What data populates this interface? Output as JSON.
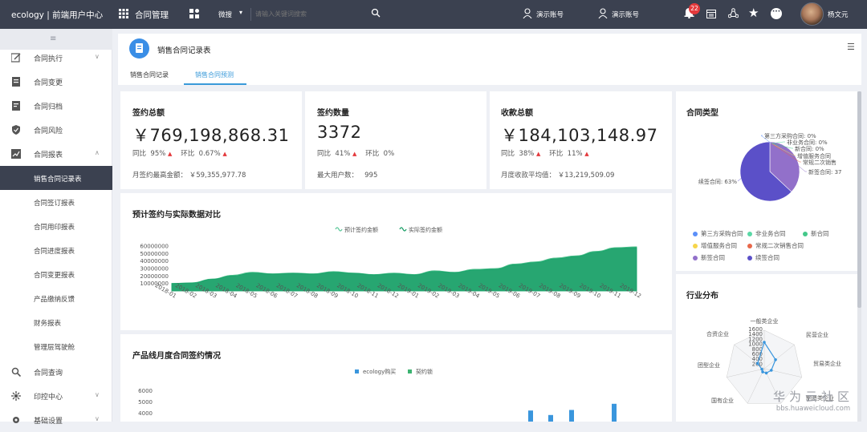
{
  "topbar": {
    "brand": "ecology | 前端用户中心",
    "module": "合同管理",
    "search_scope": "微搜",
    "search_placeholder": "请输入关键词搜索",
    "demo_account_1": "演示账号",
    "demo_account_2": "演示账号",
    "notification_count": "22",
    "username": "杨文元"
  },
  "sidebar": {
    "items": [
      {
        "label": "合同执行",
        "icon": "edit-icon",
        "chevron": "v"
      },
      {
        "label": "合同变更",
        "icon": "document-icon"
      },
      {
        "label": "合同归档",
        "icon": "archive-icon"
      },
      {
        "label": "合同风险",
        "icon": "shield-icon"
      },
      {
        "label": "合同报表",
        "icon": "chart-icon",
        "chevron": "^"
      }
    ],
    "subitems": [
      {
        "label": "销售合同记录表",
        "active": true
      },
      {
        "label": "合同签订报表"
      },
      {
        "label": "合同用印报表"
      },
      {
        "label": "合同进度报表"
      },
      {
        "label": "合同变更报表"
      },
      {
        "label": "产品缴纳反馈"
      },
      {
        "label": "财务报表"
      },
      {
        "label": "管理层驾驶舱"
      }
    ],
    "bottom_items": [
      {
        "label": "合同查询",
        "icon": "search-icon"
      },
      {
        "label": "印控中心",
        "icon": "settings-icon",
        "chevron": "v"
      },
      {
        "label": "基础设置",
        "icon": "gear-icon",
        "chevron": "v"
      }
    ]
  },
  "page": {
    "title": "销售合同记录表",
    "tabs": [
      {
        "label": "销售合同记录",
        "active": false
      },
      {
        "label": "销售合同预测",
        "active": true
      }
    ]
  },
  "kpis": [
    {
      "title": "签约总额",
      "value": "￥769,198,868.31",
      "yoy_label": "同比",
      "yoy": "95%",
      "yoy_up": true,
      "mom_label": "环比",
      "mom": "0.67%",
      "mom_up": true,
      "footer_label": "月签约最高金额：",
      "footer_value": "￥59,355,977.78"
    },
    {
      "title": "签约数量",
      "value": "3372",
      "yoy_label": "同比",
      "yoy": "41%",
      "yoy_up": true,
      "mom_label": "环比",
      "mom": "0%",
      "mom_up": false,
      "footer_label": "最大用户数：",
      "footer_value": "995"
    },
    {
      "title": "收款总额",
      "value": "￥184,103,148.97",
      "yoy_label": "同比",
      "yoy": "38%",
      "yoy_up": true,
      "mom_label": "环比",
      "mom": "11%",
      "mom_up": true,
      "footer_label": "月度收款平均值：",
      "footer_value": "￥13,219,509.09"
    }
  ],
  "chart_data": [
    {
      "type": "area",
      "title": "预计签约与实际数据对比",
      "legend": [
        "预计签约金额",
        "实际签约金额"
      ],
      "x": [
        "2018-01",
        "2018-02",
        "2018-03",
        "2018-04",
        "2018-05",
        "2018-06",
        "2018-07",
        "2018-08",
        "2018-09",
        "2018-10",
        "2018-11",
        "2018-12",
        "2019-01",
        "2019-02",
        "2019-03",
        "2019-04",
        "2019-05",
        "2019-06",
        "2019-07",
        "2019-08",
        "2019-09",
        "2019-10",
        "2019-11",
        "2019-12"
      ],
      "ylim": [
        0,
        60000000
      ],
      "yticks": [
        "60000000",
        "50000000",
        "40000000",
        "30000000",
        "20000000",
        "10000000"
      ],
      "series": [
        {
          "name": "预计签约金额",
          "values": [
            10000000,
            11000000,
            16000000,
            21000000,
            25000000,
            23000000,
            24000000,
            23000000,
            26000000,
            24000000,
            22000000,
            24000000,
            22000000,
            27000000,
            25000000,
            29000000,
            30000000,
            36000000,
            39000000,
            44000000,
            47000000,
            53000000,
            58000000,
            59000000
          ]
        },
        {
          "name": "实际签约金额",
          "values": [
            10000000,
            10500000,
            15500000,
            20000000,
            24000000,
            22500000,
            23500000,
            22500000,
            25000000,
            23500000,
            21500000,
            23000000,
            21500000,
            26000000,
            24500000,
            28000000,
            29000000,
            35000000,
            38000000,
            43000000,
            46000000,
            52000000,
            57000000,
            58000000
          ]
        }
      ],
      "colors": [
        "#5fc99c",
        "#1c9f68"
      ]
    },
    {
      "type": "pie",
      "title": "合同类型",
      "labels": [
        "第三方采购合同",
        "非业务合同",
        "新合同",
        "增值服务合同",
        "常规二次销售",
        "新签合同",
        "续签合同"
      ],
      "values": [
        0,
        0,
        0,
        0,
        0,
        37,
        63
      ],
      "value_labels": [
        "第三方采购合同: 0%",
        "非业务合同: 0%",
        "新合同: 0%",
        "增值服务合同",
        "常规二次销售",
        "新签合同: 37",
        "续签合同: 63%"
      ],
      "legend": [
        "第三方采购合同",
        "非业务合同",
        "新合同",
        "增值服务合同",
        "常规二次销售合同",
        "新签合同",
        "续签合同"
      ],
      "colors": [
        "#5b8ff9",
        "#5ad8a6",
        "#44c88a",
        "#f6d54a",
        "#e8684a",
        "#9270ca",
        "#5b50c8"
      ]
    },
    {
      "type": "radar",
      "title": "行业分布",
      "indicators": [
        "一般类企业",
        "民营企业",
        "贸易类企业",
        "制造类企业",
        "国有企业",
        "团型企业",
        "合资企业"
      ],
      "rticks": [
        "1600",
        "1400",
        "1200",
        "1000",
        "800",
        "600",
        "400",
        "200"
      ],
      "max": 1600,
      "values": [
        1100,
        600,
        300,
        200,
        150,
        100,
        350
      ],
      "color": "#3a96dd"
    },
    {
      "type": "bar",
      "title": "产品线月度合同签约情况",
      "legend": [
        "ecology购买",
        "契约锁"
      ],
      "ylim": [
        0,
        6000
      ],
      "yticks": [
        "6000",
        "5000",
        "4000"
      ],
      "colors": [
        "#3a96dd",
        "#3cb371"
      ],
      "visible_bars": [
        {
          "series": "ecology购买",
          "value": 4200
        },
        {
          "series": "ecology购买",
          "value": 3800
        },
        {
          "series": "ecology购买",
          "value": 4250
        },
        {
          "series": "ecology购买",
          "value": 4800
        }
      ]
    }
  ],
  "watermark": {
    "line1": "华为云社区",
    "line2": "bbs.huaweicloud.com"
  }
}
